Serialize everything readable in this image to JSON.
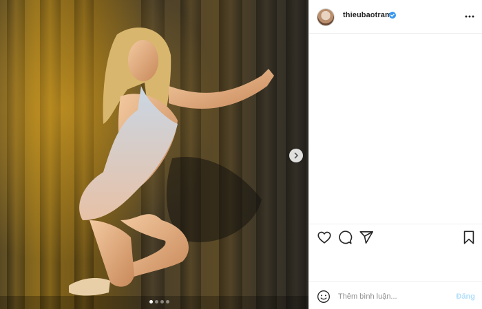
{
  "post": {
    "username": "thieubaotram",
    "verified": true,
    "carousel": {
      "current_slide": 1,
      "total_slides": 4
    },
    "comment_box": {
      "placeholder": "Thêm bình luận...",
      "value": "",
      "post_label": "Đăng"
    },
    "icons": {
      "more": "more-options-icon",
      "like": "heart-icon",
      "comment": "comment-bubble-icon",
      "share": "paper-plane-icon",
      "save": "bookmark-icon",
      "emoji": "emoji-icon",
      "next": "chevron-right-icon",
      "verified": "verified-badge-icon"
    },
    "colors": {
      "verified_blue": "#3897f0",
      "post_button_disabled": "#b2dffc",
      "text": "#262626",
      "muted": "#8e8e8e",
      "divider": "#efefef"
    }
  }
}
